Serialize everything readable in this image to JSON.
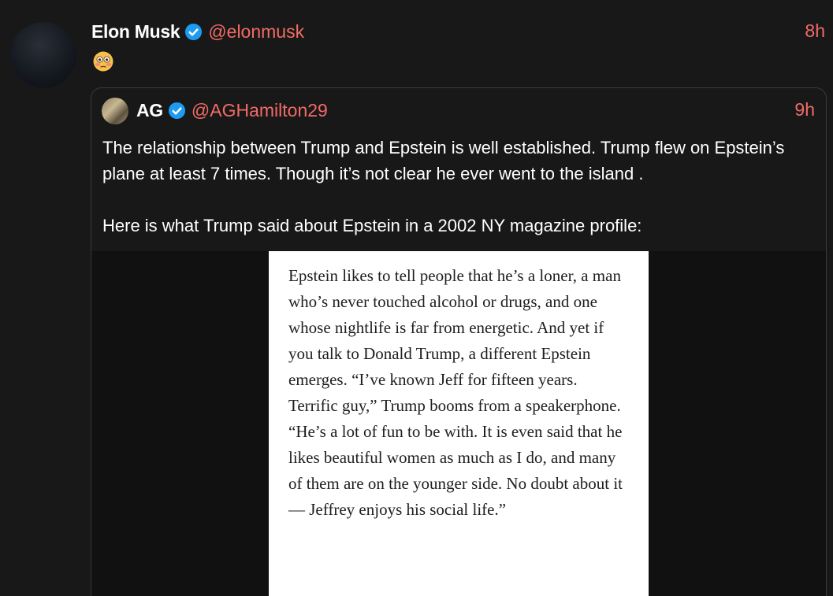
{
  "tweet": {
    "author_name": "Elon Musk",
    "author_handle": "@elonmusk",
    "time": "8h",
    "emoji": "flushed-face",
    "verified": true
  },
  "quoted": {
    "author_name": "AG",
    "author_handle": "@AGHamilton29",
    "time": "9h",
    "verified": true,
    "paragraph1": "The relationship between Trump and Epstein is well established. Trump flew on Epstein’s plane at least 7 times. Though it’s not clear he ever went to the island .",
    "paragraph2": "Here is what Trump said about Epstein in a 2002 NY magazine profile:",
    "image_text": "Epstein likes to tell people that he’s a loner, a man who’s never touched alcohol or drugs, and one whose nightlife is far from energetic. And yet if you talk to Donald Trump, a different Epstein emerges. “I’ve known Jeff for fifteen years. Terrific guy,” Trump booms from a speakerphone. “He’s a lot of fun to be with. It is even said that he likes beautiful women as much as I do, and many of them are on the younger side. No doubt about it — Jeffrey enjoys his social life.”"
  },
  "colors": {
    "background": "#181818",
    "handle_accent": "#f26b66",
    "verified_badge": "#1d9bf0"
  }
}
